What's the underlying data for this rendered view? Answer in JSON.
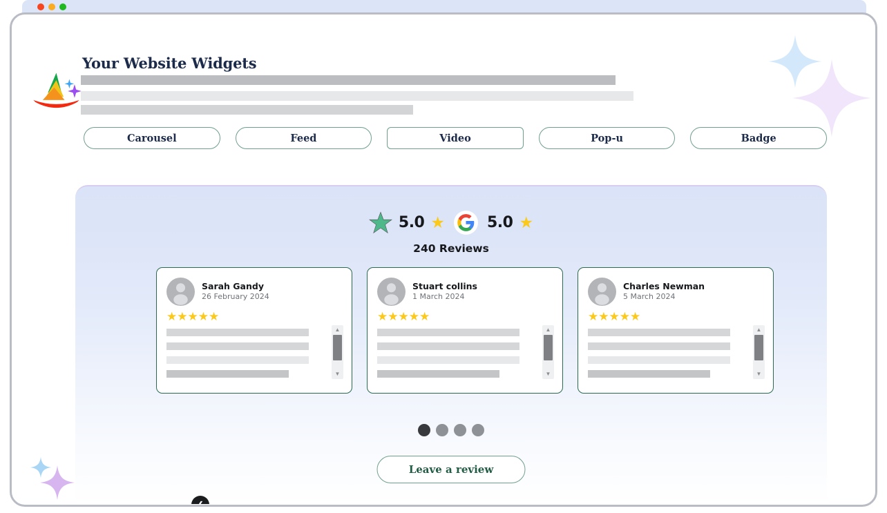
{
  "window": {
    "traffic_lights": [
      "close",
      "minimize",
      "maximize"
    ]
  },
  "header": {
    "title": "Your Website Widgets",
    "logo_name": "wizard-hat-logo"
  },
  "tabs": [
    {
      "label": "Carousel",
      "shape": "pill",
      "active": false
    },
    {
      "label": "Feed",
      "shape": "pill",
      "active": false
    },
    {
      "label": "Video",
      "shape": "squared",
      "active": true
    },
    {
      "label": "Pop-u",
      "shape": "pill",
      "active": false
    },
    {
      "label": "Badge",
      "shape": "pill",
      "active": false
    }
  ],
  "widget": {
    "rating_left": {
      "icon": "trustpilot-green-star",
      "score": "5.0",
      "star_icon": "yellow-star"
    },
    "rating_right": {
      "icon": "google-g-logo",
      "score": "5.0",
      "star_icon": "yellow-star"
    },
    "reviews_count": "240 Reviews",
    "reviews": [
      {
        "name": "Sarah Gandy",
        "date": "26 February 2024",
        "stars": "★★★★★",
        "avatar": "default-avatar"
      },
      {
        "name": "Stuart collins",
        "date": "1 March 2024",
        "stars": "★★★★★",
        "avatar": "default-avatar"
      },
      {
        "name": "Charles Newman",
        "date": "5 March 2024",
        "stars": "★★★★★",
        "avatar": "default-avatar"
      }
    ],
    "nav": {
      "prev_icon": "chevron-left-icon",
      "next_icon": "chevron-right-icon",
      "prev_glyph": "❮",
      "next_glyph": "❯"
    },
    "pagination": {
      "total": 4,
      "active_index": 0
    },
    "cta_label": "Leave a review"
  },
  "colors": {
    "accent_green": "#2b6a4e",
    "tab_border": "#6f9e8c",
    "title_navy": "#1c2b4a",
    "star_yellow": "#fbc91c",
    "trustpilot_green": "#4db98a",
    "panel_top": "#dbe3f8",
    "nav_dark": "#1b1c1e"
  }
}
